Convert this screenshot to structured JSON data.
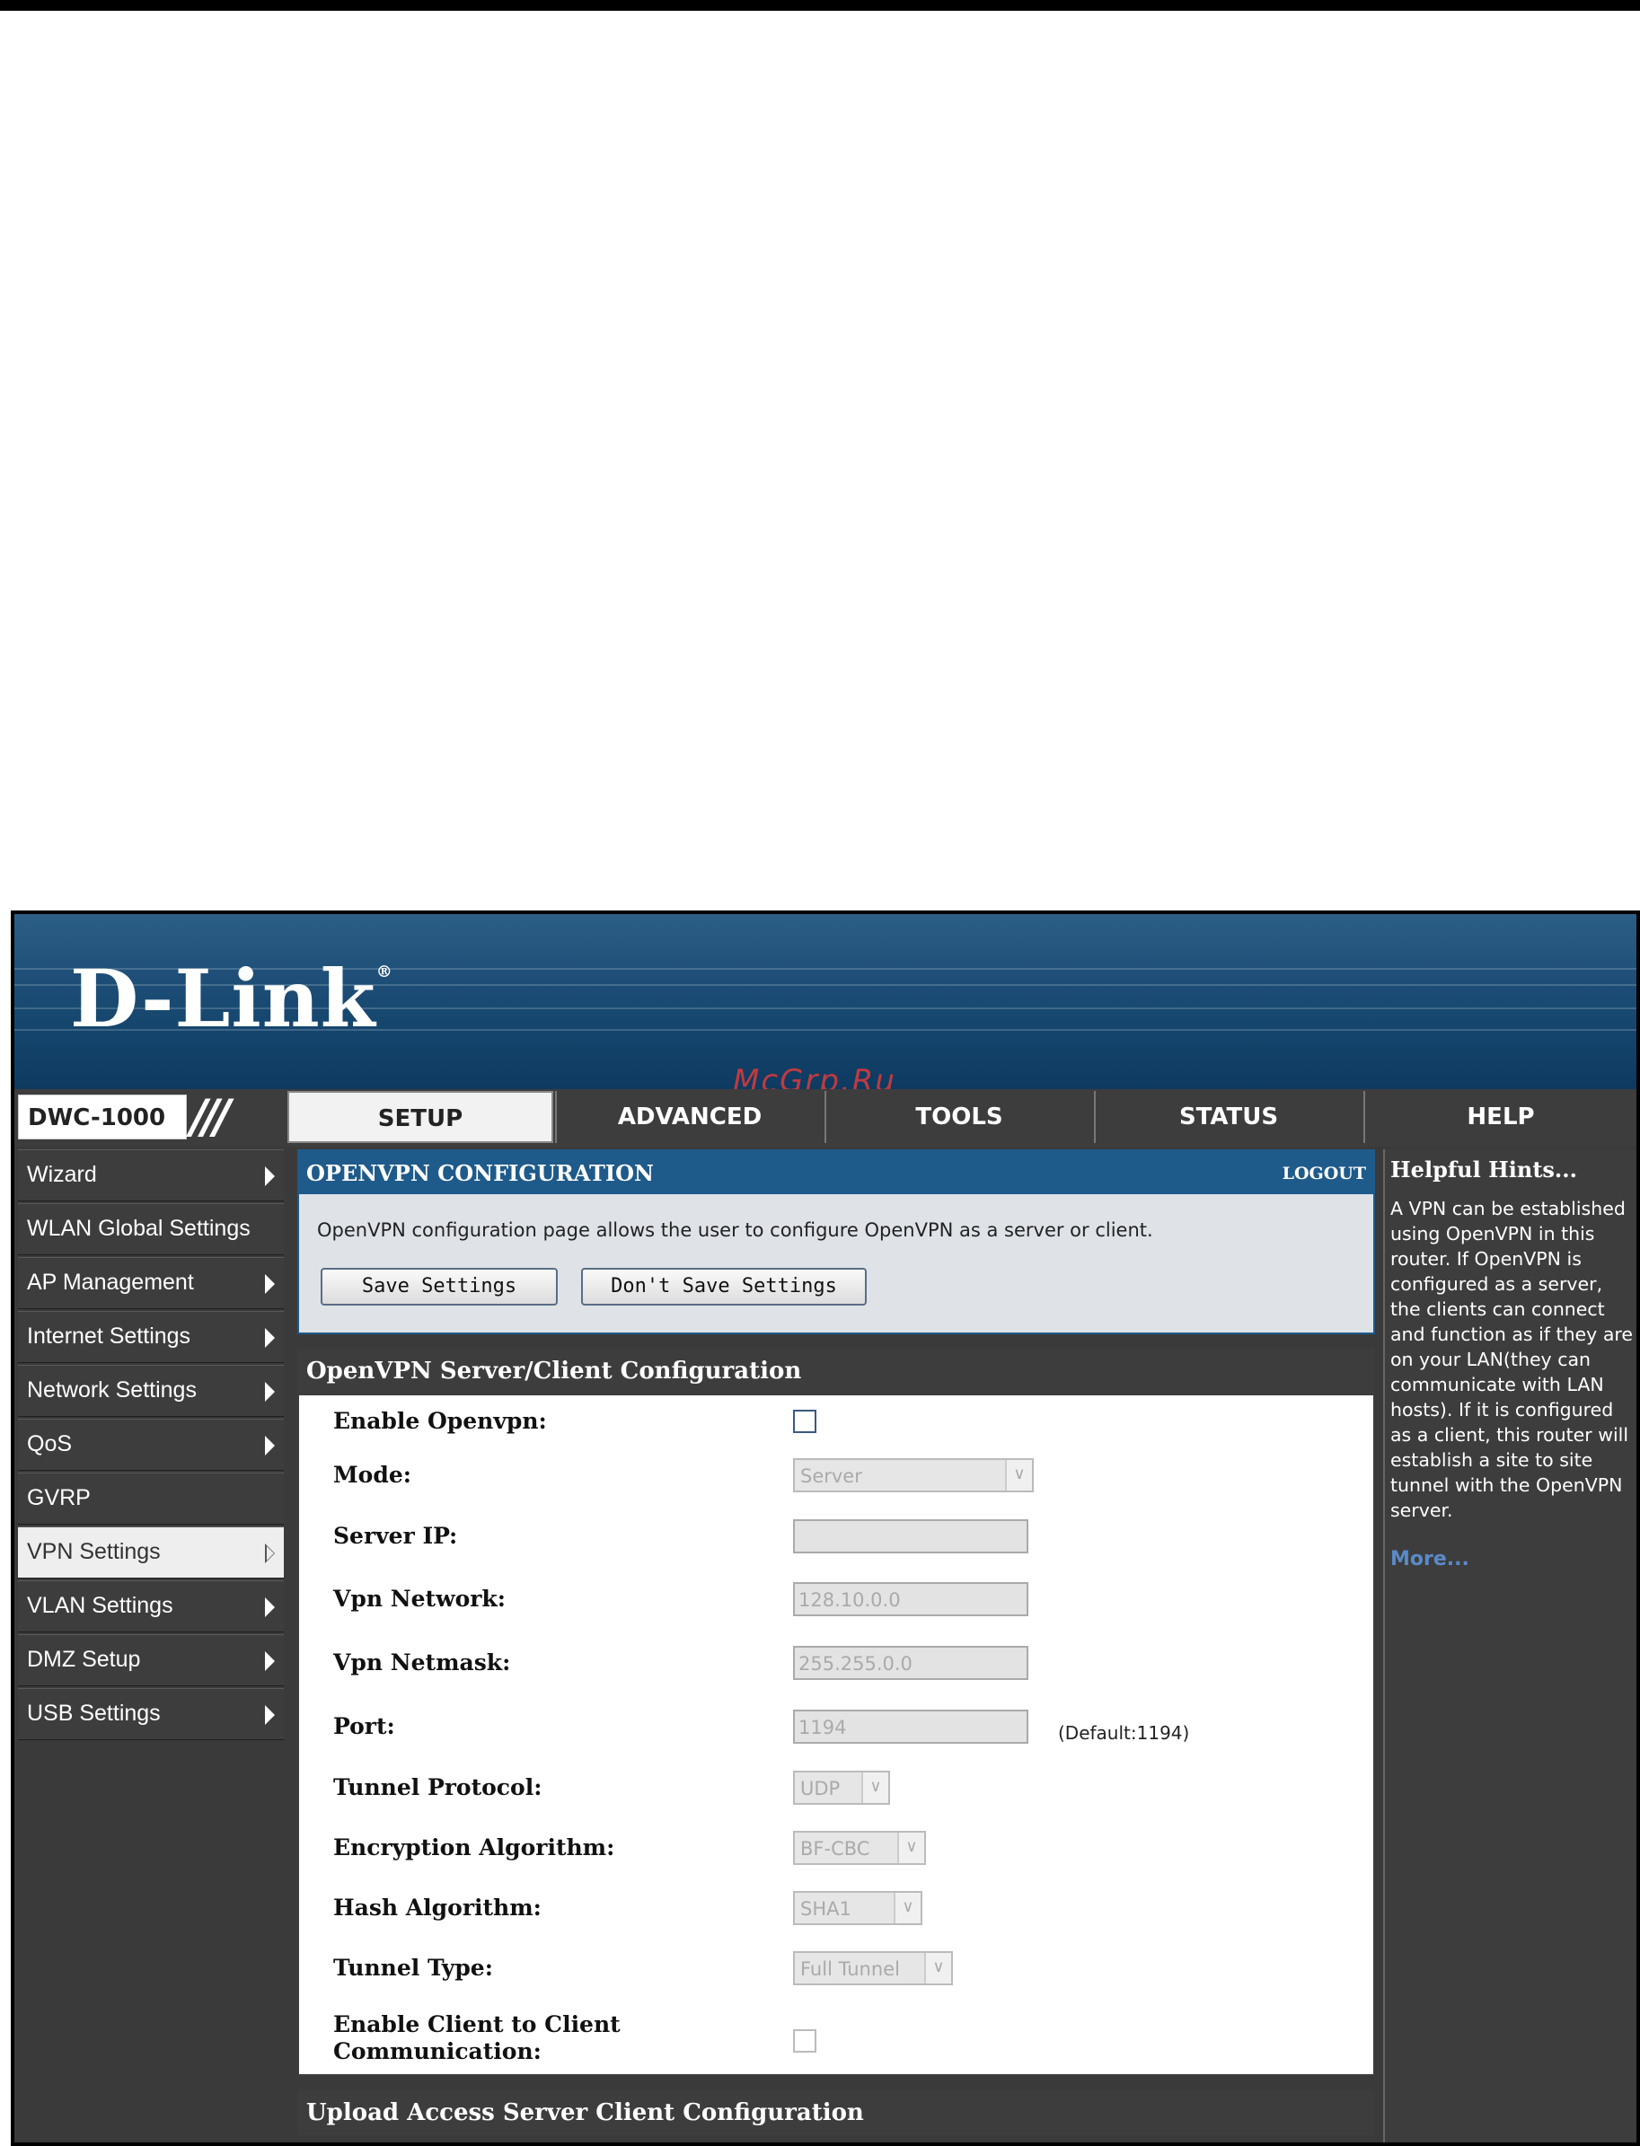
{
  "banner": {
    "brand": "D-Link",
    "registered": "®",
    "watermark": "McGrp.Ru"
  },
  "nav": {
    "model": "DWC-1000",
    "tabs": [
      "SETUP",
      "ADVANCED",
      "TOOLS",
      "STATUS",
      "HELP"
    ],
    "active_tab": "SETUP"
  },
  "sidebar": {
    "items": [
      {
        "label": "Wizard"
      },
      {
        "label": "WLAN Global Settings"
      },
      {
        "label": "AP Management"
      },
      {
        "label": "Internet Settings"
      },
      {
        "label": "Network Settings"
      },
      {
        "label": "QoS"
      },
      {
        "label": "GVRP"
      },
      {
        "label": "VPN Settings"
      },
      {
        "label": "VLAN Settings"
      },
      {
        "label": "DMZ Setup"
      },
      {
        "label": "USB Settings"
      }
    ],
    "active_item": "VPN Settings"
  },
  "main": {
    "header": "OPENVPN CONFIGURATION",
    "logout": "LOGOUT",
    "description": "OpenVPN configuration page allows the user to configure OpenVPN as a server or client.",
    "save_label": "Save Settings",
    "dont_save_label": "Don't Save Settings",
    "section_title": "OpenVPN Server/Client Configuration",
    "fields": {
      "enable_openvpn": "Enable Openvpn:",
      "mode": "Mode:",
      "mode_value": "Server",
      "server_ip": "Server IP:",
      "server_ip_value": "",
      "vpn_network": "Vpn Network:",
      "vpn_network_value": "128.10.0.0",
      "vpn_netmask": "Vpn Netmask:",
      "vpn_netmask_value": "255.255.0.0",
      "port": "Port:",
      "port_value": "1194",
      "port_default": "(Default:1194)",
      "tunnel_protocol": "Tunnel Protocol:",
      "tunnel_protocol_value": "UDP",
      "encryption_algorithm": "Encryption Algorithm:",
      "encryption_algorithm_value": "BF-CBC",
      "hash_algorithm": "Hash Algorithm:",
      "hash_algorithm_value": "SHA1",
      "tunnel_type": "Tunnel Type:",
      "tunnel_type_value": "Full Tunnel",
      "client_to_client_line1": "Enable Client to Client",
      "client_to_client_line2": "Communication:"
    },
    "upload_section_title": "Upload Access Server Client Configuration"
  },
  "hints": {
    "title": "Helpful Hints...",
    "text": "A VPN can be established using OpenVPN in this router. If OpenVPN is configured as a server, the clients can connect and function as if they are on your LAN(they can communicate with LAN hosts). If it is configured as a client, this router will establish a site to site tunnel with the OpenVPN server.",
    "more": "More..."
  },
  "colors": {
    "header_blue": "#1e5a8a",
    "panel_dark": "#3d3d3d",
    "link_blue": "#5a8ac8",
    "watermark_red": "#e03a3a"
  }
}
